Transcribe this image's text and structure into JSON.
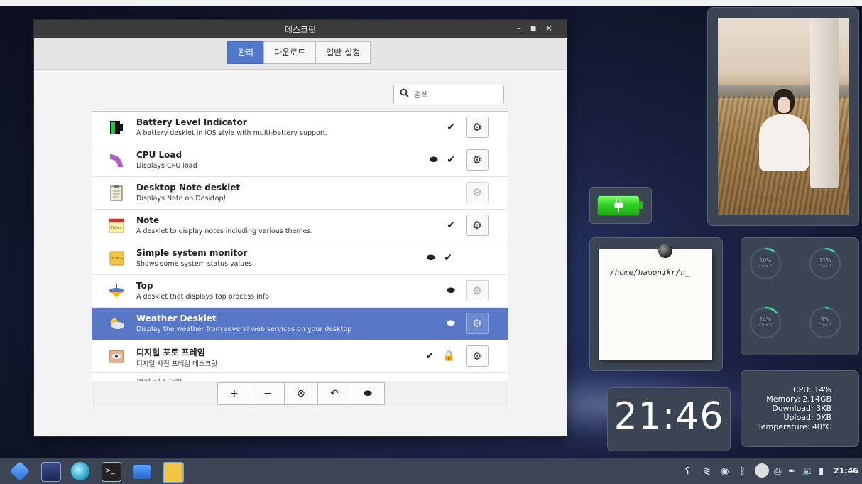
{
  "window": {
    "title": "데스크릿",
    "controls": {
      "minimize": "–",
      "maximize": "■",
      "close": "✕"
    },
    "tabs": [
      {
        "label": "관리",
        "active": true
      },
      {
        "label": "다운로드",
        "active": false
      },
      {
        "label": "일반 설정",
        "active": false
      }
    ],
    "search": {
      "placeholder": "검색",
      "value": ""
    },
    "desklets": [
      {
        "name": "Battery Level Indicator",
        "description": "A battery desklet in iOS style with multi-battery support.",
        "status": "✔",
        "config_enabled": true,
        "selected": false,
        "icon": "battery-icon"
      },
      {
        "name": "CPU Load",
        "description": "Displays CPU load",
        "status": "⬬ ✔",
        "config_enabled": true,
        "selected": false,
        "icon": "cpu-load-icon"
      },
      {
        "name": "Desktop Note desklet",
        "description": "Displays Note on Desktop!",
        "status": "",
        "config_enabled": false,
        "selected": false,
        "icon": "clipboard-note-icon"
      },
      {
        "name": "Note",
        "description": "A desklet to display notes including various themes.",
        "status": "✔",
        "config_enabled": true,
        "selected": false,
        "icon": "notes-icon"
      },
      {
        "name": "Simple system monitor",
        "description": "Shows some system status values",
        "status": "⬬ ✔",
        "config_enabled": null,
        "selected": false,
        "icon": "sticky-note-icon"
      },
      {
        "name": "Top",
        "description": "A desklet that displays top process info",
        "status": "⬬",
        "config_enabled": false,
        "selected": false,
        "icon": "spinning-top-icon"
      },
      {
        "name": "Weather Desklet",
        "description": "Display the weather from several web services on your desktop",
        "status": "⬬",
        "config_enabled": false,
        "selected": true,
        "icon": "weather-icon"
      },
      {
        "name": "디지털 포토 프레임",
        "description": "디지털 사진 프레임 데스크릿",
        "status": "✔ 🔒",
        "config_enabled": true,
        "selected": false,
        "icon": "photo-frame-icon"
      }
    ],
    "partial_row": "경험 데스크릿",
    "bottom_buttons": [
      "+",
      "−",
      "⊗",
      "↶",
      "⬬"
    ]
  },
  "desklets_on_desktop": {
    "note_text": "/home/hamonikr/n_",
    "cpu_cores": [
      {
        "pct": "10%",
        "label": "Core 0",
        "value": 0.1
      },
      {
        "pct": "11%",
        "label": "Core 1",
        "value": 0.11
      },
      {
        "pct": "14%",
        "label": "Core 2",
        "value": 0.14
      },
      {
        "pct": "5%",
        "label": "Core 3",
        "value": 0.05
      }
    ],
    "clock": "21:46",
    "sysmon": {
      "cpu": "CPU: 14%",
      "memory": "Memory: 2.14GB",
      "download": "Download: 3KB",
      "upload": "Upload: 0KB",
      "temperature": "Temperature: 40°C"
    }
  },
  "panel": {
    "launchers": [
      "menu-icon",
      "workspace-icon",
      "browser-icon",
      "terminal-icon",
      "files-icon",
      "notes-app-icon"
    ],
    "tray_icons": [
      "app-indicator-icon",
      "network-icon",
      "vpn-icon",
      "bluetooth-icon",
      "user-icon",
      "printer-icon",
      "pen-icon",
      "volume-icon",
      "battery-tray-icon"
    ],
    "time": "21:46"
  },
  "colors": {
    "accent": "#5278c9",
    "selected_row": "#5877c6",
    "titlebar": "#3b3b3b",
    "panel": "#3c4555",
    "battery_green": "#2fcf22"
  }
}
